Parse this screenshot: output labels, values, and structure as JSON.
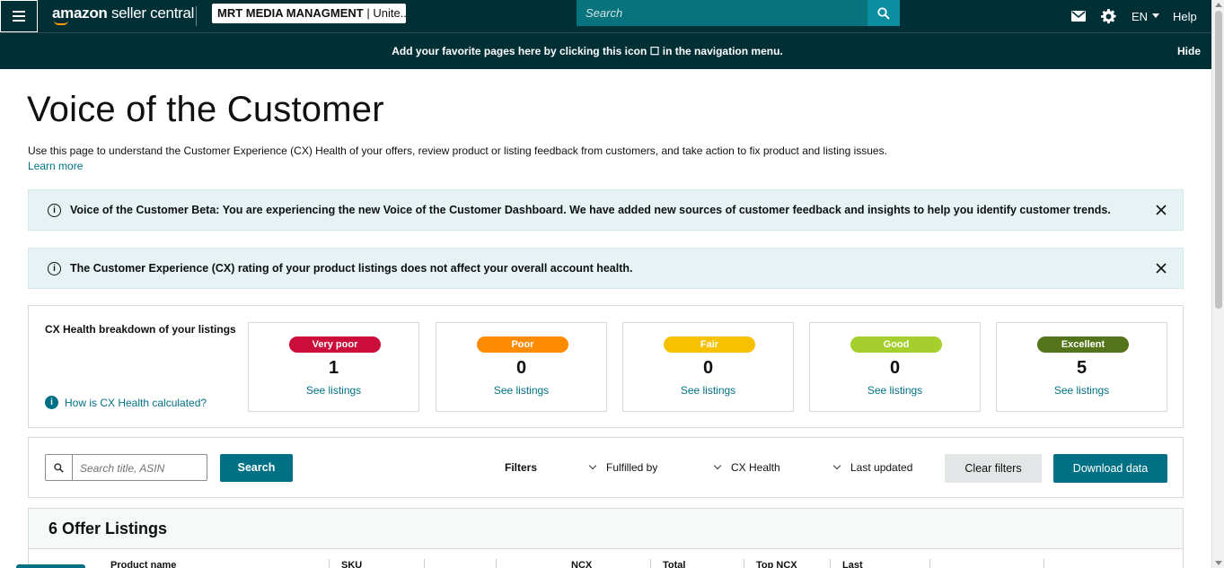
{
  "nav": {
    "logo_brand": "amazon",
    "logo_rest": "seller central",
    "account_name": "MRT MEDIA MANAGMENT",
    "account_region": "| Unite...",
    "search_placeholder": "Search",
    "language": "EN",
    "help": "Help"
  },
  "favbar": {
    "message": "Add your favorite pages here by clicking this icon ☐ in the navigation menu.",
    "hide": "Hide"
  },
  "page": {
    "title": "Voice of the Customer",
    "intro": "Use this page to understand the Customer Experience (CX) Health of your offers, review product or listing feedback from customers, and take action to fix product and listing issues.",
    "learn_more": "Learn more"
  },
  "alerts": [
    {
      "text": "Voice of the Customer Beta: You are experiencing the new Voice of the Customer Dashboard. We have added new sources of customer feedback and insights to help you identify customer trends."
    },
    {
      "text": "The Customer Experience (CX) rating of your product listings does not affect your overall account health."
    }
  ],
  "cx_health": {
    "label": "CX Health breakdown of your listings",
    "help_link": "How is CX Health calculated?",
    "cards": [
      {
        "label": "Very poor",
        "count": "1",
        "link": "See listings",
        "color": "#cc0c39"
      },
      {
        "label": "Poor",
        "count": "0",
        "link": "See listings",
        "color": "#ff8c00"
      },
      {
        "label": "Fair",
        "count": "0",
        "link": "See listings",
        "color": "#f8c100"
      },
      {
        "label": "Good",
        "count": "0",
        "link": "See listings",
        "color": "#a4cf2c"
      },
      {
        "label": "Excellent",
        "count": "5",
        "link": "See listings",
        "color": "#54741a"
      }
    ]
  },
  "filters": {
    "search_placeholder": "Search title, ASIN",
    "search_button": "Search",
    "filters_label": "Filters",
    "dropdowns": [
      "Fulfilled by",
      "CX Health",
      "Last updated"
    ],
    "clear_button": "Clear filters",
    "download_button": "Download data"
  },
  "listings": {
    "title": "6 Offer Listings",
    "columns": [
      "Product name",
      "SKU",
      "NCX",
      "Total",
      "Top NCX",
      "Last"
    ]
  }
}
